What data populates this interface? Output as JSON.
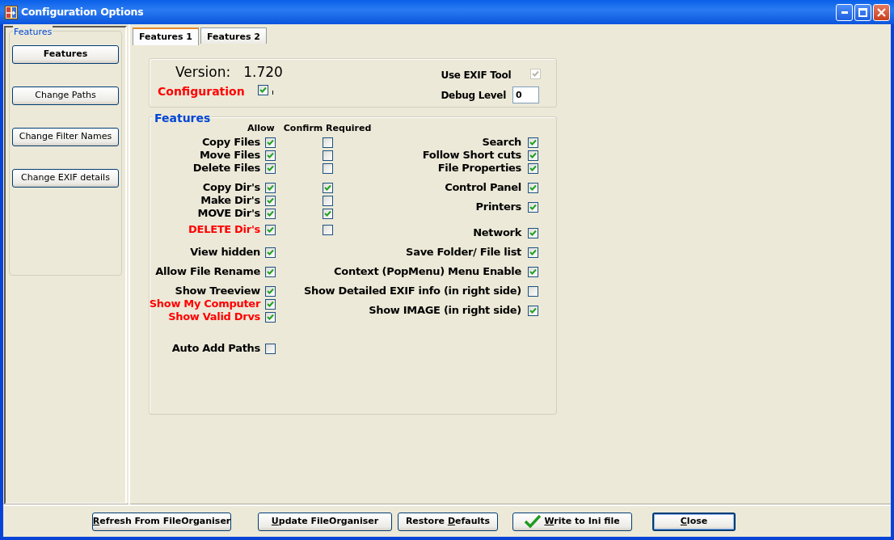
{
  "window": {
    "title": "Configuration Options"
  },
  "sidebar": {
    "group_title": "Features",
    "items": [
      {
        "label": "Features",
        "selected": true
      },
      {
        "label": "Change Paths",
        "selected": false
      },
      {
        "label": "Change Filter Names",
        "selected": false
      },
      {
        "label": "Change EXIF details",
        "selected": false
      }
    ]
  },
  "tabs": [
    {
      "label": "Features 1",
      "selected": true
    },
    {
      "label": "Features 2",
      "selected": false
    }
  ],
  "general": {
    "version_label": "Version:",
    "version_value": "1.720",
    "configuration_label": "Configuration",
    "configuration_checked": true,
    "exif_label": "Use EXIF Tool",
    "exif_checked": true,
    "exif_disabled": true,
    "debug_label": "Debug Level",
    "debug_value": "0"
  },
  "features": {
    "title": "Features",
    "allow_header": "Allow",
    "confirm_header": "Confirm Required",
    "left": [
      {
        "label": "Copy Files",
        "color": "#000000",
        "allow": true,
        "confirm": false
      },
      {
        "label": "Move Files",
        "color": "#000000",
        "allow": true,
        "confirm": false
      },
      {
        "label": "Delete Files",
        "color": "#000000",
        "allow": true,
        "confirm": false
      },
      {
        "label": "Copy Dir's",
        "color": "#000000",
        "allow": true,
        "confirm": true
      },
      {
        "label": "Make Dir's",
        "color": "#000000",
        "allow": true,
        "confirm": false
      },
      {
        "label": "MOVE Dir's",
        "color": "#000000",
        "allow": true,
        "confirm": true
      },
      {
        "label": "DELETE Dir's",
        "color": "#ff0000",
        "allow": true,
        "confirm": false
      },
      {
        "label": "View hidden",
        "color": "#000000",
        "allow": true
      },
      {
        "label": "Allow File Rename",
        "color": "#000000",
        "allow": true
      },
      {
        "label": "Show Treeview",
        "color": "#000000",
        "allow": true
      },
      {
        "label": "Show My Computer",
        "color": "#ff0000",
        "allow": true
      },
      {
        "label": "Show Valid Drvs",
        "color": "#ff0000",
        "allow": true
      },
      {
        "label": "Auto Add Paths",
        "color": "#000000",
        "allow": false
      }
    ],
    "right": [
      {
        "label": "Search",
        "checked": true
      },
      {
        "label": "Follow Short cuts",
        "checked": true
      },
      {
        "label": "File Properties",
        "checked": true
      },
      {
        "label": "Control Panel",
        "checked": true
      },
      {
        "label": "Printers",
        "checked": true
      },
      {
        "label": "Network",
        "checked": true
      },
      {
        "label": "Save Folder/ File list",
        "checked": true
      },
      {
        "label": "Context (PopMenu) Menu Enable",
        "checked": true
      },
      {
        "label": "Show Detailed EXIF info (in right side)",
        "checked": false
      },
      {
        "label": "Show IMAGE (in right side)",
        "checked": true
      }
    ]
  },
  "buttons": [
    {
      "hotkey": "R",
      "label_end": "efresh From FileOrganiser",
      "kind": "plain",
      "default": false
    },
    {
      "hotkey": "U",
      "label_end": "pdate FileOrganiser",
      "kind": "plain",
      "default": false
    },
    {
      "label_start": "Restore ",
      "hotkey": "D",
      "label_end": "efaults",
      "kind": "plain",
      "default": false
    },
    {
      "hotkey": "W",
      "label_end": "rite to Ini file",
      "kind": "check",
      "default": false
    },
    {
      "hotkey": "C",
      "label_end": "lose",
      "kind": "plain",
      "default": true
    }
  ]
}
